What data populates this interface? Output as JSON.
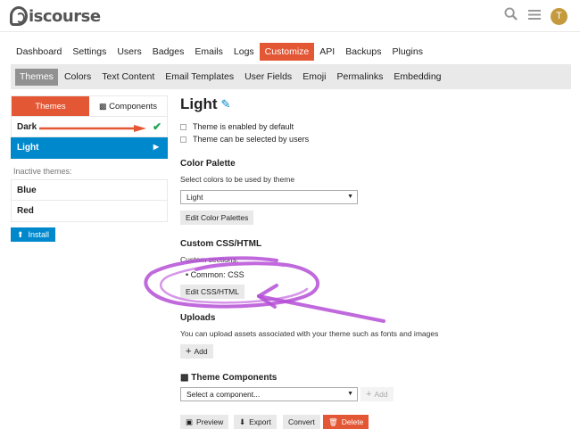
{
  "header": {
    "logo_text": "iscourse",
    "avatar_letter": "T"
  },
  "nav": [
    "Dashboard",
    "Settings",
    "Users",
    "Badges",
    "Emails",
    "Logs",
    "Customize",
    "API",
    "Backups",
    "Plugins"
  ],
  "subnav": [
    "Themes",
    "Colors",
    "Text Content",
    "Email Templates",
    "User Fields",
    "Emoji",
    "Permalinks",
    "Embedding"
  ],
  "sidebar": {
    "tab_themes": "Themes",
    "tab_components": "Components",
    "active_themes": [
      "Dark",
      "Light"
    ],
    "inactive_label": "Inactive themes:",
    "inactive_themes": [
      "Blue",
      "Red"
    ],
    "install_label": "Install"
  },
  "main": {
    "title": "Light",
    "default_cb": "Theme is enabled by default",
    "selectable_cb": "Theme can be selected by users",
    "palette_heading": "Color Palette",
    "palette_desc": "Select colors to be used by theme",
    "palette_value": "Light",
    "edit_palettes": "Edit Color Palettes",
    "css_heading": "Custom CSS/HTML",
    "css_sections": "Custom sections:",
    "css_item": "Common: CSS",
    "edit_css": "Edit CSS/HTML",
    "uploads_heading": "Uploads",
    "uploads_desc": "You can upload assets associated with your theme such as fonts and images",
    "add_label": "Add",
    "components_heading": "Theme Components",
    "component_placeholder": "Select a component...",
    "preview": "Preview",
    "export": "Export",
    "convert": "Convert",
    "delete": "Delete"
  },
  "colors": {
    "accent": "#e45735",
    "primary_blue": "#0088cc",
    "success": "#1ca551",
    "annotation": "#b54fd6"
  }
}
